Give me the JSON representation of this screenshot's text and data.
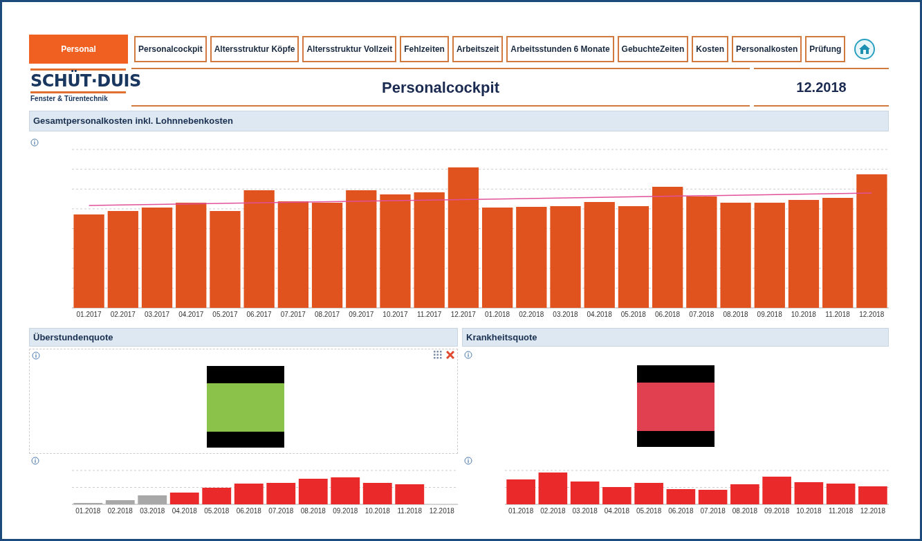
{
  "nav": {
    "tabs": [
      {
        "label": "Personal",
        "selected": true
      },
      {
        "label": "Personalcockpit",
        "selected": false
      },
      {
        "label": "Altersstruktur Köpfe",
        "selected": false
      },
      {
        "label": "Altersstruktur Vollzeit",
        "selected": false
      },
      {
        "label": "Fehlzeiten",
        "selected": false
      },
      {
        "label": "Arbeitszeit",
        "selected": false
      },
      {
        "label": "Arbeitsstunden 6 Monate",
        "selected": false
      },
      {
        "label": "GebuchteZeiten",
        "selected": false
      },
      {
        "label": "Kosten",
        "selected": false
      },
      {
        "label": "Personalkosten",
        "selected": false
      },
      {
        "label": "Prüfung",
        "selected": false
      }
    ]
  },
  "header": {
    "logo": {
      "name": "SCHÜT·DUIS",
      "tagline": "Fenster & Türentechnik"
    },
    "title": "Personalcockpit",
    "period": "12.2018"
  },
  "cost_chart": {
    "title": "Gesamtpersonalkosten inkl. Lohnnebenkosten",
    "x_labels": [
      "01.2017",
      "02.2017",
      "03.2017",
      "04.2017",
      "05.2017",
      "06.2017",
      "07.2017",
      "08.2017",
      "09.2017",
      "10.2017",
      "11.2017",
      "12.2017",
      "01.2018",
      "02.2018",
      "03.2018",
      "04.2018",
      "05.2018",
      "06.2018",
      "07.2018",
      "08.2018",
      "09.2018",
      "10.2018",
      "11.2018",
      "12.2018"
    ]
  },
  "panels": [
    {
      "title": "Überstundenquote",
      "color": "#8bc34a",
      "x_labels": [
        "01.2018",
        "02.2018",
        "03.2018",
        "04.2018",
        "05.2018",
        "06.2018",
        "07.2018",
        "08.2018",
        "09.2018",
        "10.2018",
        "11.2018",
        "12.2018"
      ]
    },
    {
      "title": "Krankheitsquote",
      "color": "#e04050",
      "x_labels": [
        "01.2018",
        "02.2018",
        "03.2018",
        "04.2018",
        "05.2018",
        "06.2018",
        "07.2018",
        "08.2018",
        "09.2018",
        "10.2018",
        "11.2018",
        "12.2018"
      ]
    }
  ]
}
